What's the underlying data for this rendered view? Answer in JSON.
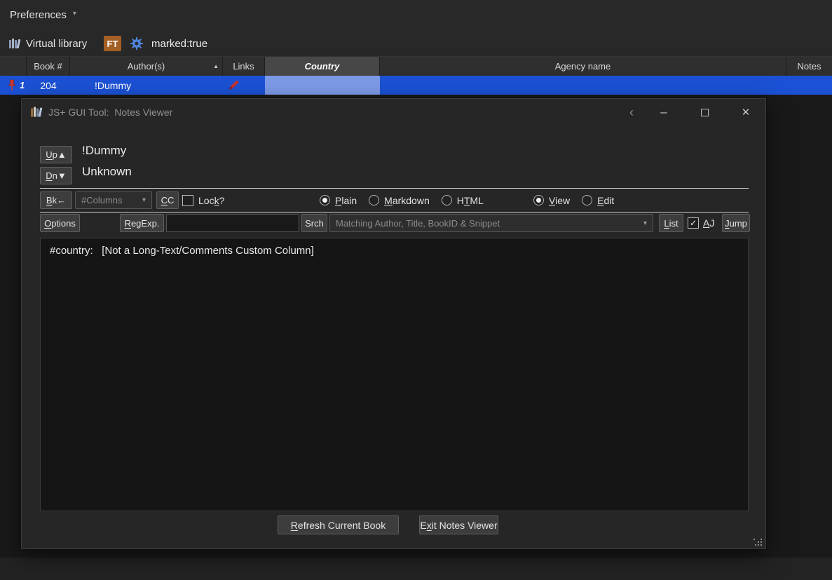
{
  "menubar": {
    "preferences_label": "Preferences"
  },
  "toolbar": {
    "virtual_library_label": "Virtual library",
    "ft_badge": "FT",
    "search_value": "marked:true"
  },
  "table": {
    "headers": {
      "book_num": "Book #",
      "authors": "Author(s)",
      "links": "Links",
      "country": "Country",
      "agency": "Agency name",
      "notes": "Notes"
    },
    "row": {
      "row_index": "1",
      "book_num": "204",
      "authors": "!Dummy"
    }
  },
  "dialog": {
    "title": "JS+ GUI Tool:  Notes Viewer",
    "book_title": "!Dummy",
    "book_author": "Unknown",
    "buttons": {
      "up": "Up▲",
      "down": "Dn▼",
      "back": "Bk←",
      "cc": "CC",
      "options": "Options",
      "regexp": "RegExp.",
      "srch": "Srch",
      "list": "List",
      "jump": "Jump",
      "refresh": "Refresh Current Book",
      "exit": "Exit Notes Viewer"
    },
    "columns_dropdown": "#Columns",
    "lock_label": "Lock?",
    "format_options": [
      "Plain",
      "Markdown",
      "HTML"
    ],
    "format_selected": "Plain",
    "mode_options": [
      "View",
      "Edit"
    ],
    "mode_selected": "View",
    "aj_label": "AJ",
    "search_placeholder": "Matching Author, Title, BookID & Snippet",
    "notes_content": "#country:   [Not a Long-Text/Comments Custom Column]"
  },
  "icons": {
    "menu_caret": "▾",
    "sort_ascending": "▲",
    "combo_caret": "▾",
    "checkmark": "✓",
    "window_back": "‹",
    "window_minimize": "–",
    "window_close": "✕"
  },
  "colors": {
    "selected_row": "#1b51d4",
    "country_cell": "#7d9ae7",
    "ft_badge": "#a45f24",
    "dialog_bg": "#262626",
    "accent_gear": "#4d82d8",
    "pin_red": "#cf3b2e"
  }
}
